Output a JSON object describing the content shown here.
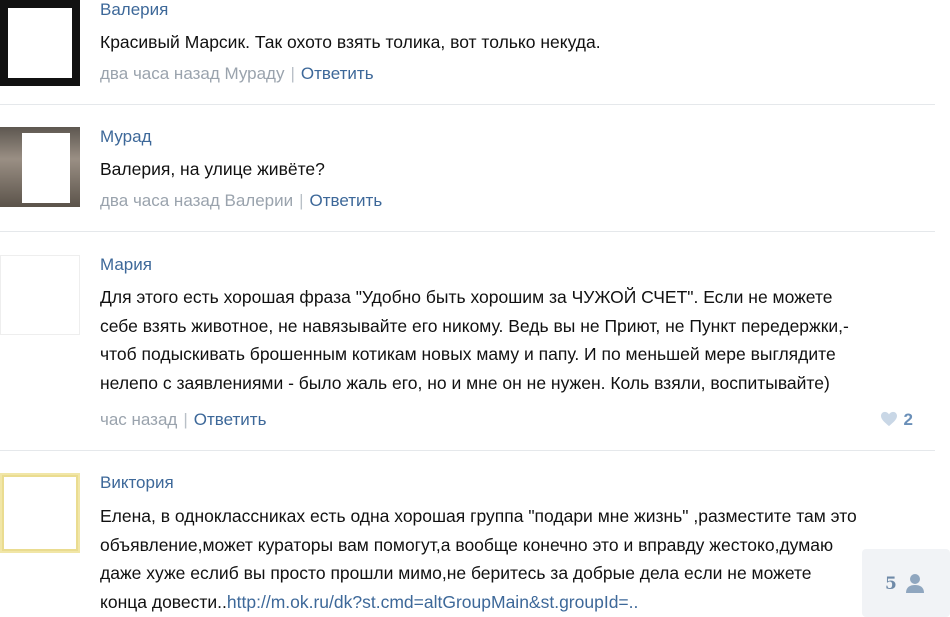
{
  "comments": [
    {
      "author": "Валерия",
      "text": "Красивый Марсик. Так охото взять толика, вот только некуда.",
      "time": "два часа назад",
      "to": "Мураду",
      "reply": "Ответить"
    },
    {
      "author": "Мурад",
      "text": "Валерия, на улице живёте?",
      "time": "два часа назад",
      "to": "Валерии",
      "reply": "Ответить"
    },
    {
      "author": "Мария",
      "lines": [
        "Для этого есть хорошая фраза \"Удобно быть хорошим за ЧУЖОЙ СЧЕТ\". Если не можете",
        "себе взять животное, не навязывайте его никому. Ведь вы не Приют, не Пункт передержки,-",
        "чтоб подыскивать брошенным котикам новых маму и папу. И по меньшей мере выглядите",
        "нелепо с заявлениями - было жаль его, но и мне он не нужен. Коль взяли, воспитывайте)"
      ],
      "time": "час назад",
      "reply": "Ответить",
      "likes": "2"
    },
    {
      "author": "Виктория",
      "lines": [
        "Елена, в одноклассниках есть одна хорошая группа \"подари мне жизнь\" ,разместите там это",
        "объявление,может кураторы вам помогут,а вообще конечно это и вправду жестоко,думаю",
        "даже хуже еслиб вы просто прошли мимо,не беритесь за добрые дела если не можете",
        "конца довести.."
      ],
      "link": "http://m.ok.ru/dk?st.cmd=altGroupMain&st.groupId=.."
    }
  ],
  "widget": {
    "count": "5",
    "icon": "person-icon"
  },
  "colors": {
    "link": "#3d6899",
    "meta": "#9aa3ad",
    "text": "#111111"
  }
}
